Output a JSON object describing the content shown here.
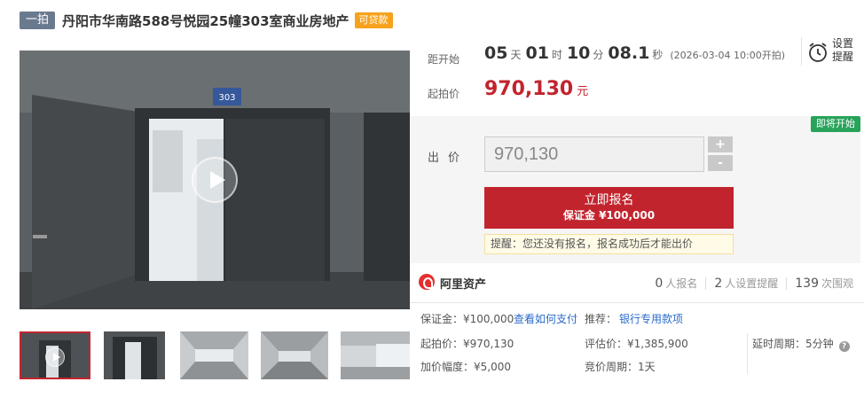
{
  "header": {
    "round_tag": "一拍",
    "title": "丹阳市华南路588号悦园25幢303室商业房地产",
    "loan_tag": "可贷款"
  },
  "media": {
    "door_number": "303",
    "thumbnail_count": 5
  },
  "countdown": {
    "label": "距开始",
    "days": "05",
    "days_unit": "天",
    "hours": "01",
    "hours_unit": "时",
    "minutes": "10",
    "minutes_unit": "分",
    "seconds": "08.1",
    "seconds_unit": "秒",
    "start_time": "(2026-03-04 10:00开拍)"
  },
  "reminder": {
    "label": "设置 提醒",
    "icon": "alarm-clock-icon"
  },
  "price": {
    "label": "起拍价",
    "amount": "970,130",
    "unit": "元",
    "color": "#c2242e"
  },
  "bid": {
    "status_tag": "即将开始",
    "label": "出价",
    "input_value": "970,130",
    "plus": "+",
    "minus": "-",
    "signup_label": "立即报名",
    "deposit_line": "保证金 ¥100,000",
    "notice": "提醒：您还没有报名，报名成功后才能出价"
  },
  "platform": {
    "name": "阿里资产",
    "icon": "ali-asset-logo-icon",
    "signups": "0",
    "signups_label": "人报名",
    "reminders": "2",
    "reminders_label": "人设置提醒",
    "views": "139",
    "views_label": "次围观"
  },
  "details": {
    "deposit": "保证金：¥100,000",
    "how_to_pay": "查看如何支付",
    "recommend_label": "推荐：",
    "bank_link": "银行专用款项",
    "start_price": "起拍价：¥970,130",
    "valuation": "评估价：¥1,385,900",
    "delay_period": "延时周期：5分钟",
    "increment": "加价幅度：¥5,000",
    "bid_period": "竞价周期：1天"
  },
  "colors": {
    "accent_red": "#c2242e",
    "link_blue": "#2a6ac8",
    "tag_green": "#27a35a",
    "tag_orange": "#f7a21d"
  }
}
